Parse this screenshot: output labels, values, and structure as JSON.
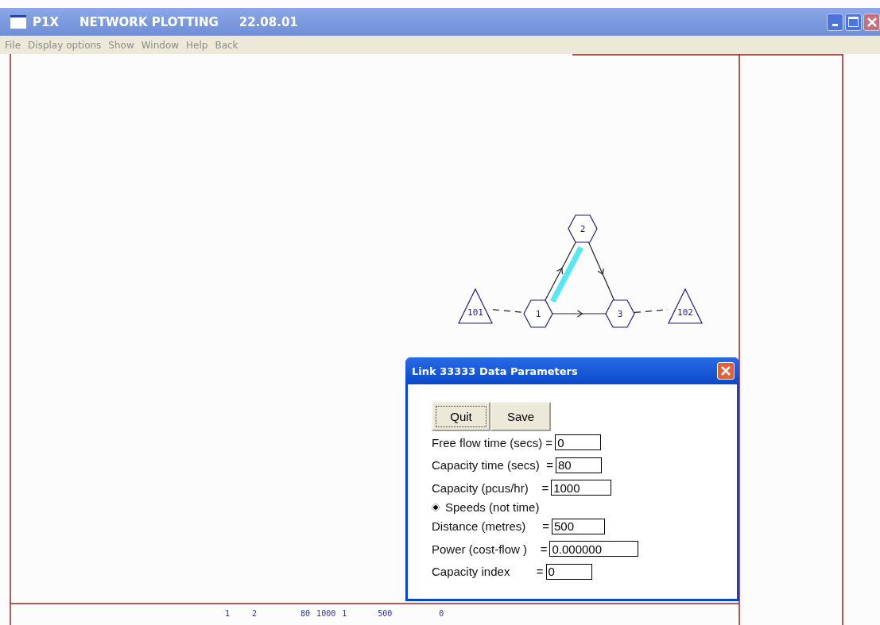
{
  "window": {
    "app": "P1X",
    "title": "NETWORK PLOTTING",
    "version": "22.08.01"
  },
  "menu": [
    "File",
    "Display options",
    "Show",
    "Window",
    "Help",
    "Back"
  ],
  "network": {
    "nodes": [
      {
        "kind": "triangle",
        "label": "101"
      },
      {
        "kind": "hexagon",
        "label": "1"
      },
      {
        "kind": "hexagon",
        "label": "2"
      },
      {
        "kind": "hexagon",
        "label": "3"
      },
      {
        "kind": "triangle",
        "label": "102"
      }
    ],
    "links": [
      {
        "kind": "dashed",
        "highlighted": false
      },
      {
        "kind": "arrow",
        "highlighted": true
      },
      {
        "kind": "arrow",
        "highlighted": false
      },
      {
        "kind": "arrow",
        "highlighted": false
      },
      {
        "kind": "dashed",
        "highlighted": false
      }
    ]
  },
  "dialog": {
    "title": "Link 33333 Data Parameters",
    "buttons": [
      {
        "label": "Quit",
        "focused": true
      },
      {
        "label": "Save",
        "focused": false
      }
    ],
    "rows": [
      {
        "kind": "field",
        "label": "Free flow time (secs) =",
        "value": "0"
      },
      {
        "kind": "field",
        "label": "Capacity time (secs)  =",
        "value": "80"
      },
      {
        "kind": "field",
        "label": "Capacity (pcus/hr)    =",
        "value": "1000"
      },
      {
        "kind": "radio",
        "label": "Speeds (not time)",
        "selected": true
      },
      {
        "kind": "field",
        "label": "Distance (metres)     =",
        "value": "500"
      },
      {
        "kind": "field",
        "label": "Power (cost-flow )    =",
        "value": "0.000000"
      },
      {
        "kind": "field",
        "label": "Capacity index        =",
        "value": "0"
      }
    ]
  },
  "status_values": [
    "1",
    "2",
    "80",
    "1000",
    "1",
    "500",
    "0"
  ]
}
